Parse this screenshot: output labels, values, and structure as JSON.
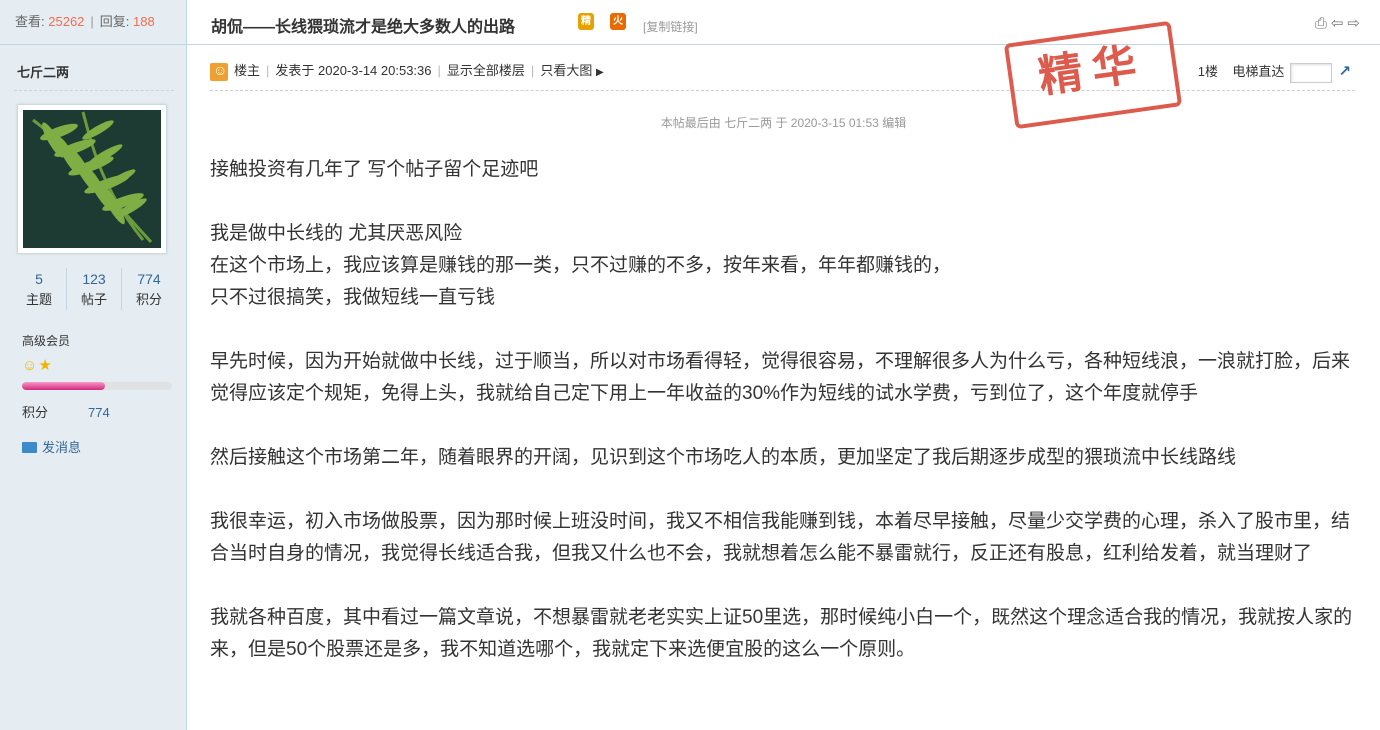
{
  "sidebar": {
    "views_label": "查看:",
    "views": "25262",
    "replies_label": "回复:",
    "replies": "188",
    "username": "七斤二两",
    "stats": [
      {
        "value": "5",
        "label": "主题"
      },
      {
        "value": "123",
        "label": "帖子"
      },
      {
        "value": "774",
        "label": "积分"
      }
    ],
    "group": "高级会员",
    "progress_fraction": 0.55,
    "score_label": "积分",
    "score": "774",
    "send_message": "发消息"
  },
  "thread": {
    "title": "胡侃——长线猥琐流才是绝大多数人的出路",
    "badge1": "精",
    "badge2": "火",
    "copy_link": "[复制链接]"
  },
  "meta": {
    "op_label": "楼主",
    "posted": "发表于 2020-3-14 20:53:36",
    "show_all": "显示全部楼层",
    "big_image": "只看大图",
    "floor": "1楼",
    "elevator": "电梯直达"
  },
  "stamp": "精华",
  "edited_note": "本帖最后由 七斤二两 于 2020-3-15 01:53 编辑",
  "content": {
    "p1": "接触投资有几年了  写个帖子留个足迹吧",
    "p2a": "我是做中长线的 尤其厌恶风险",
    "p2b": "在这个市场上，我应该算是赚钱的那一类，只不过赚的不多，按年来看，年年都赚钱的，",
    "p2c": "只不过很搞笑，我做短线一直亏钱",
    "p3": "早先时候，因为开始就做中长线，过于顺当，所以对市场看得轻，觉得很容易，不理解很多人为什么亏，各种短线浪，一浪就打脸，后来觉得应该定个规矩，免得上头，我就给自己定下用上一年收益的30%作为短线的试水学费，亏到位了，这个年度就停手",
    "p4": "然后接触这个市场第二年，随着眼界的开阔，见识到这个市场吃人的本质，更加坚定了我后期逐步成型的猥琐流中长线路线",
    "p5": "我很幸运，初入市场做股票，因为那时候上班没时间，我又不相信我能赚到钱，本着尽早接触，尽量少交学费的心理，杀入了股市里，结合当时自身的情况，我觉得长线适合我，但我又什么也不会，我就想着怎么能不暴雷就行，反正还有股息，红利给发着，就当理财了",
    "p6": "我就各种百度，其中看过一篇文章说，不想暴雷就老老实实上证50里选，那时候纯小白一个，既然这个理念适合我的情况，我就按人家的来，但是50个股票还是多，我不知道选哪个，我就定下来选便宜股的这么一个原则。"
  }
}
